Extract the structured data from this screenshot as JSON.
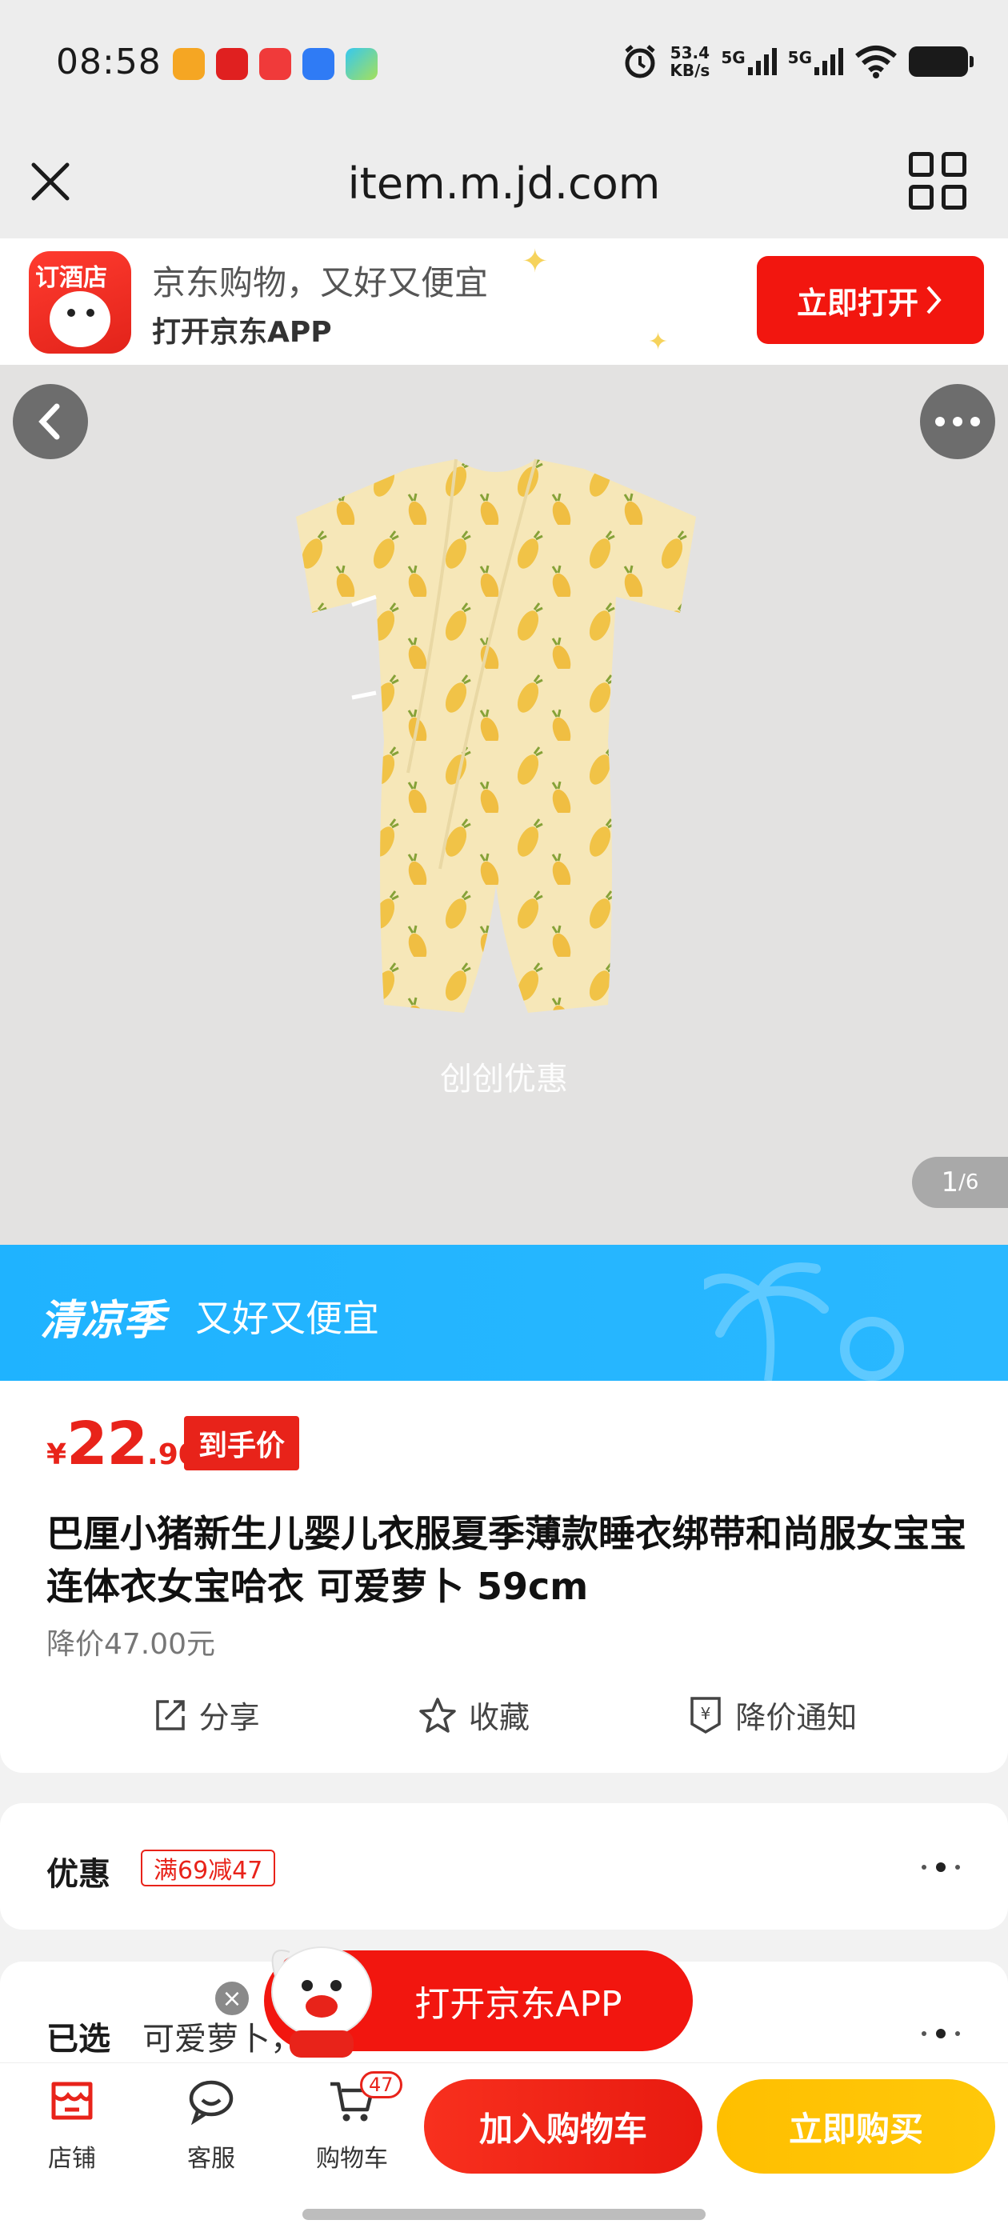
{
  "status_bar": {
    "time": "08:58",
    "net_speed_value": "53.4",
    "net_speed_unit": "KB/s",
    "signal1": "5G",
    "signal2": "5G",
    "app_icons": [
      "bilibili-icon",
      "huawei-app-icon",
      "jd-hotel-icon",
      "blue-app-icon",
      "telegram-icon"
    ]
  },
  "browser": {
    "url": "item.m.jd.com"
  },
  "banner": {
    "logo_text": "订酒店",
    "line1": "京东购物，又好又便宜",
    "line2": "打开京东APP",
    "open_button": "立即打开"
  },
  "gallery": {
    "watermark": "创创优惠",
    "current": "1",
    "total": "/6"
  },
  "promo": {
    "title": "清凉季",
    "subtitle": "又好又便宜"
  },
  "product": {
    "currency": "¥",
    "price_int": "22",
    "price_dec": ".90",
    "price_tag": "到手价",
    "title": "巴厘小猪新生儿婴儿衣服夏季薄款睡衣绑带和尚服女宝宝连体衣女宝哈衣 可爱萝卜 59cm",
    "price_drop": "降价47.00元",
    "actions": {
      "share": "分享",
      "favorite": "收藏",
      "price_alert": "降价通知"
    }
  },
  "discount": {
    "label": "优惠",
    "coupon": "满69减47"
  },
  "selected": {
    "label": "已选",
    "value": "可爱萝卜，"
  },
  "float_banner": {
    "label": "打开京东APP"
  },
  "bottom_bar": {
    "store": "店铺",
    "service": "客服",
    "cart": "购物车",
    "cart_count": "47",
    "add_to_cart": "加入购物车",
    "buy_now": "立即购买"
  },
  "colors": {
    "jd_red": "#e8231a",
    "buy_yellow": "#ffc107",
    "promo_blue": "#2ab8ff"
  }
}
